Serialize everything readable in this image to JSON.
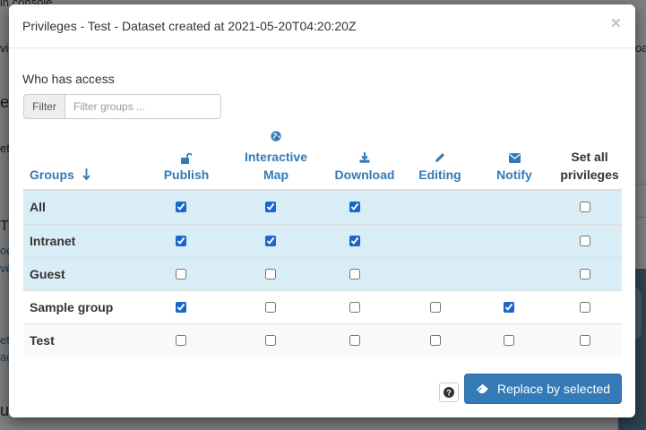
{
  "background": {
    "fragments": [
      "in console",
      "vi",
      "oa",
      "e",
      "et",
      "T",
      "oc",
      "ve",
      "et",
      "ac",
      "ut"
    ]
  },
  "modal": {
    "title": "Privileges - Test - Dataset created at 2021-05-20T04:20:20Z",
    "close_symbol": "×",
    "who_has_access": "Who has access",
    "filter": {
      "label": "Filter",
      "placeholder": "Filter groups ..."
    },
    "columns": {
      "groups": "Groups",
      "groups_sort_icon": "arrow-down-icon",
      "publish": "Publish",
      "publish_icon": "unlock-icon",
      "interactive_line1": "Interactive",
      "interactive_line2": "Map",
      "interactive_icon": "globe-icon",
      "download": "Download",
      "download_icon": "download-icon",
      "editing": "Editing",
      "editing_icon": "pencil-icon",
      "notify": "Notify",
      "notify_icon": "envelope-icon",
      "set_all_line1": "Set all",
      "set_all_line2": "privileges"
    },
    "rows": [
      {
        "name": "All",
        "publish": true,
        "interactive_map": true,
        "download": true,
        "editing": null,
        "notify": null,
        "set_all": false
      },
      {
        "name": "Intranet",
        "publish": true,
        "interactive_map": true,
        "download": true,
        "editing": null,
        "notify": null,
        "set_all": false
      },
      {
        "name": "Guest",
        "publish": false,
        "interactive_map": false,
        "download": false,
        "editing": null,
        "notify": null,
        "set_all": false
      },
      {
        "name": "Sample group",
        "publish": true,
        "interactive_map": false,
        "download": false,
        "editing": false,
        "notify": true,
        "set_all": false
      },
      {
        "name": "Test",
        "publish": false,
        "interactive_map": false,
        "download": false,
        "editing": false,
        "notify": false,
        "set_all": false
      }
    ],
    "help_icon": "question-circle-icon",
    "replace_button": {
      "label": "Replace by selected",
      "icon": "eraser-icon"
    }
  },
  "colors": {
    "accent": "#337ab7",
    "row_highlight": "#d9edf7",
    "backdrop": "rgba(0,0,0,0.5)"
  }
}
